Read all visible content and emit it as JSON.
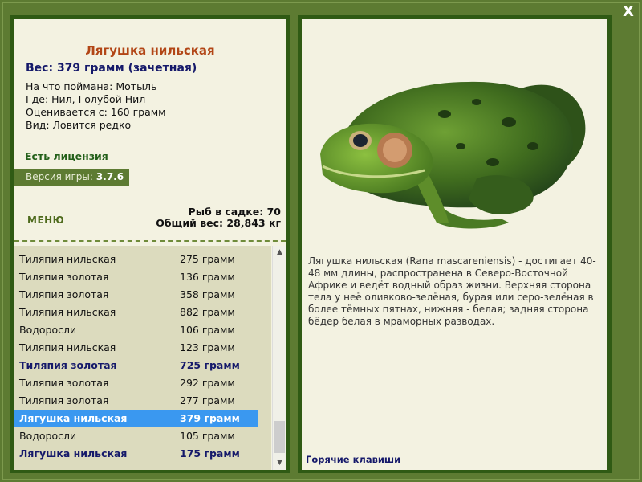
{
  "window": {
    "close_label": "X"
  },
  "fish_info": {
    "title": "Лягушка нильская",
    "weight": "Вес: 379 грамм (зачетная)",
    "caught_on": "На что поймана: Мотыль",
    "location": "Где: Нил, Голубой Нил",
    "valued_from": "Оценивается с: 160 грамм",
    "rarity": "Вид: Ловится редко"
  },
  "license_text": "Есть лицензия",
  "version": {
    "label": "Версия игры:",
    "value": "3.7.6"
  },
  "menu_label": "МЕНЮ",
  "keepnet": {
    "fish_count": "Рыб в садке: 70",
    "total_weight": "Общий вес: 28,843 кг"
  },
  "catch_list": [
    {
      "name": "Тиляпия нильская",
      "weight": "275 грамм",
      "style": "normal"
    },
    {
      "name": "Тиляпия золотая",
      "weight": "136 грамм",
      "style": "normal"
    },
    {
      "name": "Тиляпия золотая",
      "weight": "358 грамм",
      "style": "normal"
    },
    {
      "name": "Тиляпия нильская",
      "weight": "882 грамм",
      "style": "normal"
    },
    {
      "name": "Водоросли",
      "weight": "106 грамм",
      "style": "normal"
    },
    {
      "name": "Тиляпия нильская",
      "weight": "123 грамм",
      "style": "normal"
    },
    {
      "name": "Тиляпия золотая",
      "weight": "725 грамм",
      "style": "bold"
    },
    {
      "name": "Тиляпия золотая",
      "weight": "292 грамм",
      "style": "normal"
    },
    {
      "name": "Тиляпия золотая",
      "weight": "277 грамм",
      "style": "normal"
    },
    {
      "name": "Лягушка нильская",
      "weight": "379 грамм",
      "style": "selected"
    },
    {
      "name": "Водоросли",
      "weight": "105 грамм",
      "style": "normal"
    },
    {
      "name": "Лягушка нильская",
      "weight": "175 грамм",
      "style": "bold"
    }
  ],
  "description": "Лягушка нильская (Rana mascareniensis) - достигает 40-48 мм длины, распространена в Северо-Восточной Африке и ведёт водный образ жизни. Верхняя сторона тела у неё оливково-зелёная, бурая или серо-зелёная в более тёмных пятнах, нижняя - белая; задняя сторона бёдер белая в мраморных разводах.",
  "hotkeys_label": "Горячие клавиши",
  "icons": {
    "close": "close-icon",
    "scroll_up": "scroll-up-arrow-icon",
    "scroll_down": "scroll-down-arrow-icon"
  },
  "colors": {
    "frame": "#5d7b32",
    "panel_border": "#2f5a14",
    "panel_bg": "#f3f2e1",
    "list_bg": "#dcdbbe",
    "selected": "#3a98f0",
    "title": "#b24616",
    "accent_text": "#15196a"
  }
}
